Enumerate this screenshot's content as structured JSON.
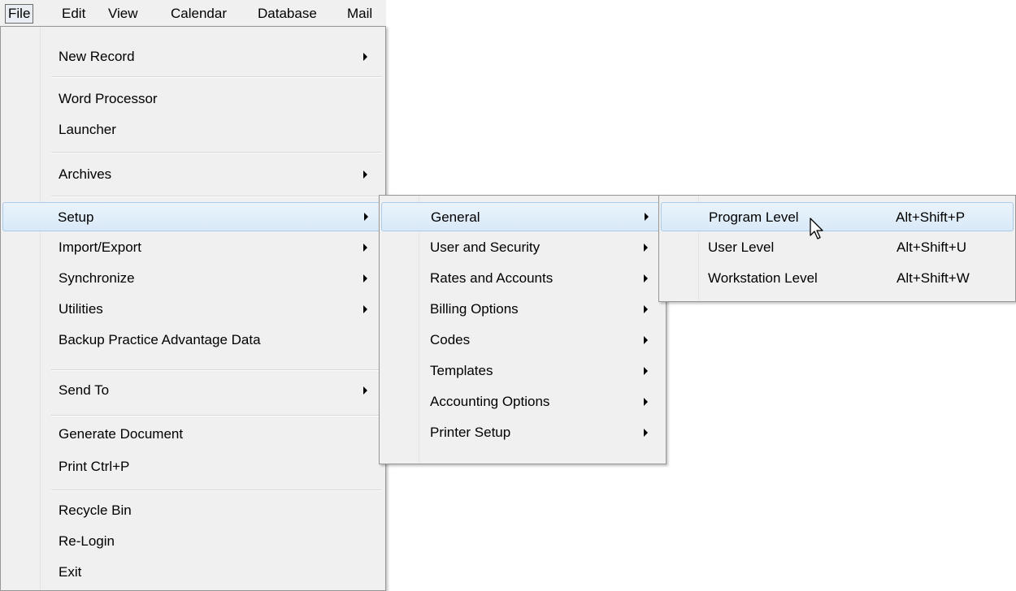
{
  "menubar": {
    "items": [
      {
        "label": "File",
        "open": true
      },
      {
        "label": "Edit"
      },
      {
        "label": "View"
      },
      {
        "label": "Calendar"
      },
      {
        "label": "Database"
      },
      {
        "label": "Mail"
      }
    ]
  },
  "file_menu": {
    "items": [
      {
        "label": "New Record",
        "submenu": true
      },
      {
        "label": "Word Processor"
      },
      {
        "label": "Launcher"
      },
      {
        "label": "Archives",
        "submenu": true
      },
      {
        "label": "Setup",
        "submenu": true,
        "highlighted": true
      },
      {
        "label": "Import/Export",
        "submenu": true
      },
      {
        "label": "Synchronize",
        "submenu": true
      },
      {
        "label": "Utilities",
        "submenu": true
      },
      {
        "label": "Backup Practice Advantage Data"
      },
      {
        "label": "Send To",
        "submenu": true
      },
      {
        "label": "Generate Document"
      },
      {
        "label": "Print  Ctrl+P"
      },
      {
        "label": "Recycle Bin"
      },
      {
        "label": "Re-Login"
      },
      {
        "label": "Exit"
      }
    ]
  },
  "setup_menu": {
    "items": [
      {
        "label": "General",
        "submenu": true,
        "highlighted": true
      },
      {
        "label": "User and Security",
        "submenu": true
      },
      {
        "label": "Rates and Accounts",
        "submenu": true
      },
      {
        "label": "Billing Options",
        "submenu": true
      },
      {
        "label": "Codes",
        "submenu": true
      },
      {
        "label": "Templates",
        "submenu": true
      },
      {
        "label": "Accounting Options",
        "submenu": true
      },
      {
        "label": "Printer Setup",
        "submenu": true
      }
    ]
  },
  "general_menu": {
    "items": [
      {
        "label": "Program Level",
        "shortcut": "Alt+Shift+P",
        "highlighted": true
      },
      {
        "label": "User Level",
        "shortcut": "Alt+Shift+U"
      },
      {
        "label": "Workstation Level",
        "shortcut": "Alt+Shift+W"
      }
    ]
  },
  "colors": {
    "menu_bg": "#f0f0f0",
    "highlight_top": "#eaf3fc",
    "highlight_bottom": "#d9e9f8",
    "highlight_border": "#a8cbea",
    "menu_border": "#979797"
  },
  "cursor_icon": "arrow-cursor-icon"
}
